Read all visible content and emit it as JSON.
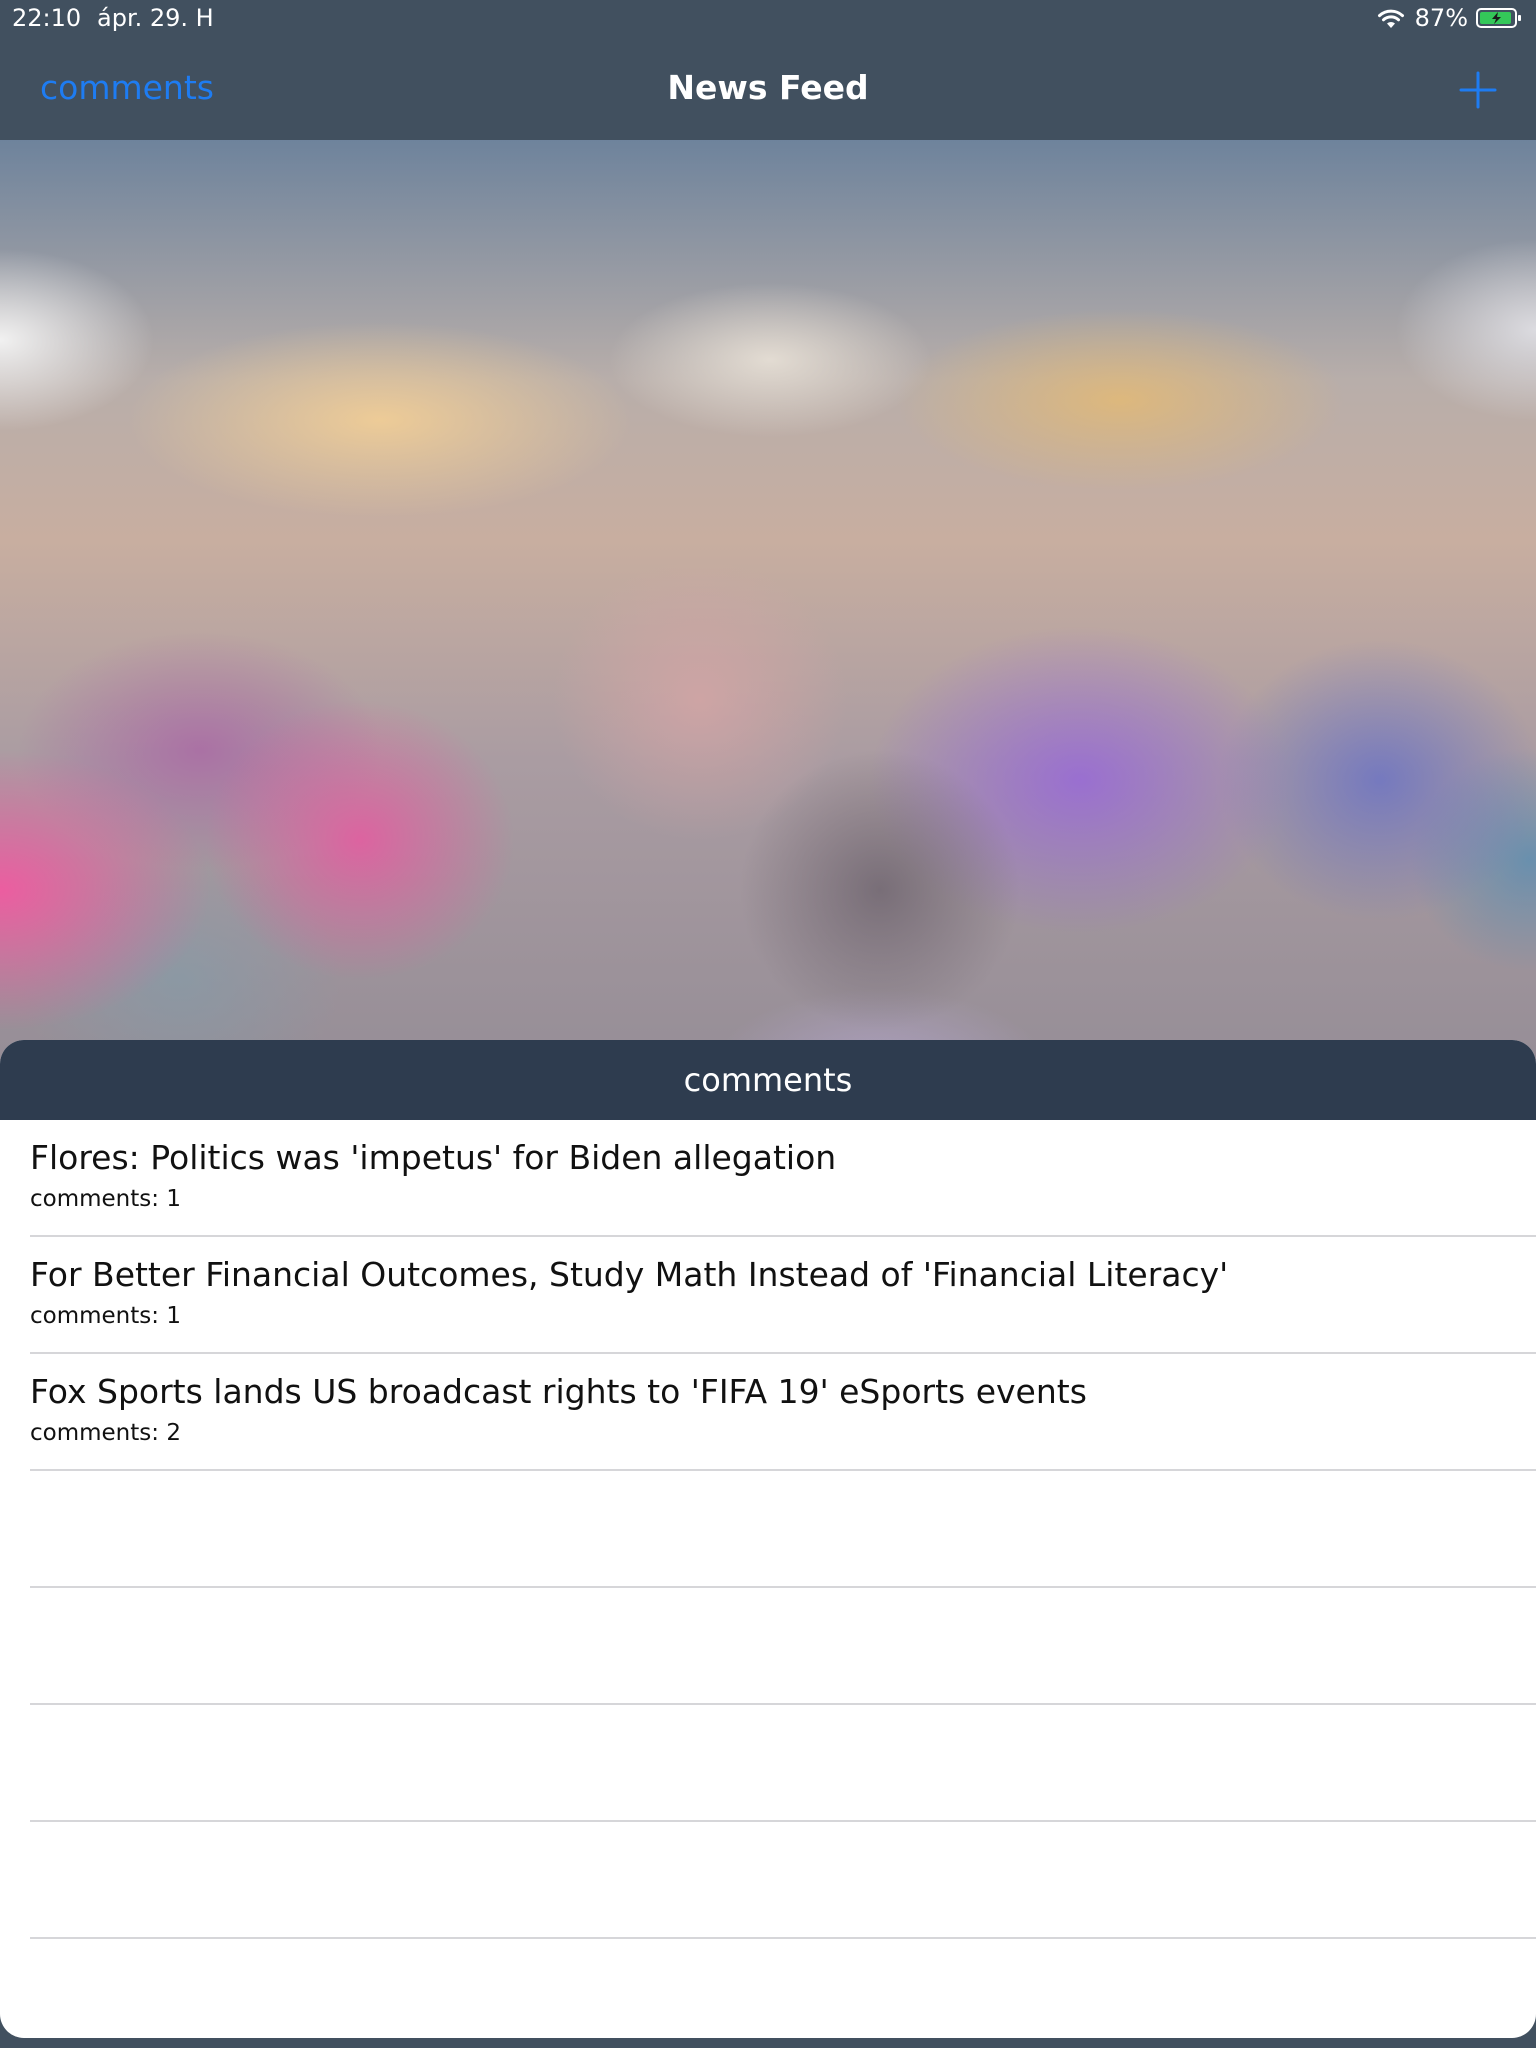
{
  "status_bar": {
    "time": "22:10",
    "date": "ápr. 29. H",
    "battery": "87%",
    "icons": [
      "wifi-icon",
      "battery-charging-icon"
    ]
  },
  "nav": {
    "left_label": "comments",
    "title": "News Feed",
    "right_icon": "plus-icon",
    "accent_color": "#1e7cf2"
  },
  "sheet": {
    "header": "comments",
    "header_color": "#2e3c4f",
    "rows": [
      {
        "title": "Flores: Politics was 'impetus' for Biden allegation",
        "subtitle": "comments: 1"
      },
      {
        "title": "For Better Financial Outcomes, Study Math Instead of 'Financial Literacy'",
        "subtitle": "comments: 1"
      },
      {
        "title": "Fox Sports lands US broadcast rights to 'FIFA 19' eSports events",
        "subtitle": "comments: 2"
      }
    ]
  }
}
